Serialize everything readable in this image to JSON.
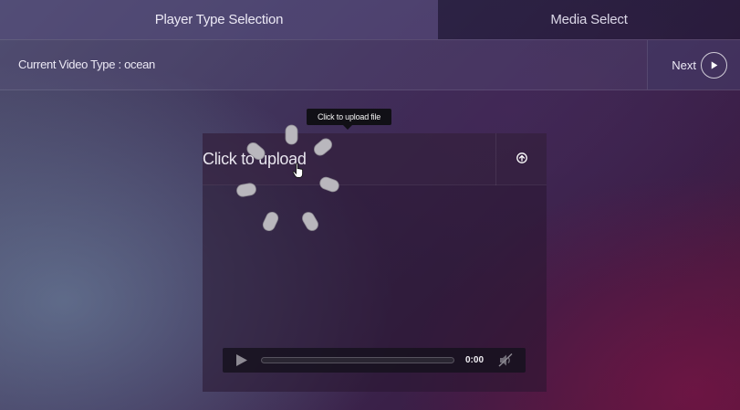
{
  "tabs": {
    "player_type": "Player Type Selection",
    "media_select": "Media Select"
  },
  "info": {
    "video_type": "Current Video Type : ocean",
    "next_label": "Next"
  },
  "tooltip": "Click to upload file",
  "upload": {
    "label": "Click to upload",
    "icon": "upload-arrow-icon"
  },
  "player": {
    "time": "0:00",
    "progress": 0,
    "play_icon": "play-icon",
    "mute_icon": "muted-speaker-icon"
  },
  "colors": {
    "tooltip_bg": "#111016",
    "control_bar_bg": "#16121e"
  }
}
